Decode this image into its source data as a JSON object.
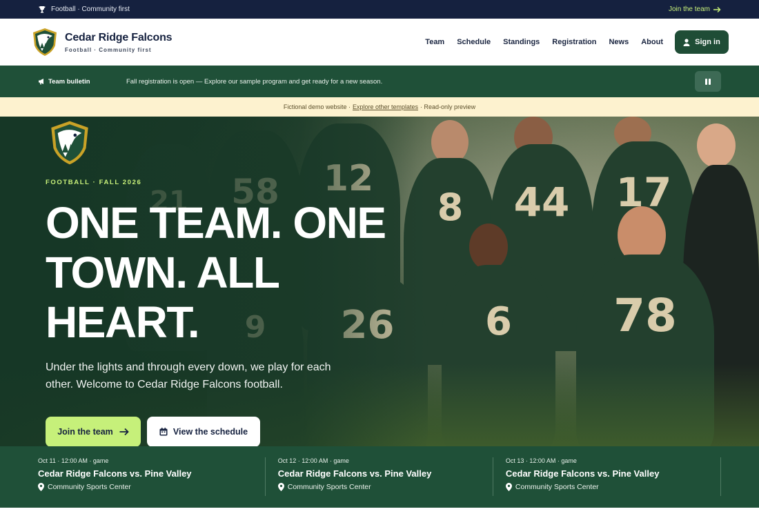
{
  "topbar": {
    "left_text": "Football · Community first",
    "right_text": "Join the team"
  },
  "brand": {
    "name": "Cedar Ridge Falcons",
    "tagline": "Football · Community first"
  },
  "nav": {
    "items": [
      "Team",
      "Schedule",
      "Standings",
      "Registration",
      "News",
      "About"
    ],
    "signin_label": "Sign in"
  },
  "bulletin": {
    "label": "Team bulletin",
    "message": "Fall registration is open — Explore our sample program and get ready for a new season."
  },
  "demo": {
    "prefix": "Fictional demo website ·",
    "link": "Explore other templates",
    "suffix": "· Read-only preview"
  },
  "hero": {
    "eyebrow": "FOOTBALL · FALL 2026",
    "headline": "ONE TEAM. ONE TOWN. ALL HEART.",
    "lede": "Under the lights and through every down, we play for each other. Welcome to Cedar Ridge Falcons football.",
    "cta_primary": "Join the team",
    "cta_secondary": "View the schedule",
    "jersey_numbers": [
      "21",
      "58",
      "12",
      "8",
      "44",
      "17",
      "26",
      "6",
      "78",
      "9"
    ]
  },
  "games": [
    {
      "meta": "Oct 11 · 12:00 AM · game",
      "title": "Cedar Ridge Falcons vs. Pine Valley",
      "location": "Community Sports Center"
    },
    {
      "meta": "Oct 12 · 12:00 AM · game",
      "title": "Cedar Ridge Falcons vs. Pine Valley",
      "location": "Community Sports Center"
    },
    {
      "meta": "Oct 13 · 12:00 AM · game",
      "title": "Cedar Ridge Falcons vs. Pine Valley",
      "location": "Community Sports Center"
    }
  ],
  "colors": {
    "navy": "#15213f",
    "green": "#1f5038",
    "lime": "#c6f07a",
    "cream": "#fdf2cf"
  }
}
